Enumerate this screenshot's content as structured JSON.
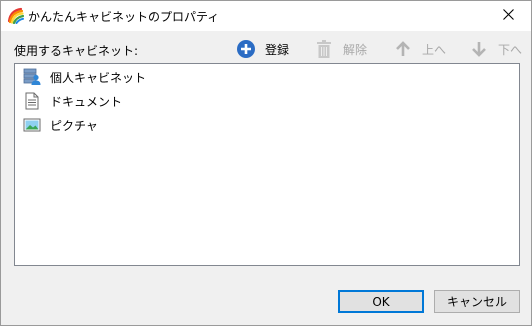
{
  "window": {
    "title": "かんたんキャビネットのプロパティ",
    "icon": "rainbow-pencils-icon",
    "close_icon": "close-icon"
  },
  "section": {
    "label": "使用するキャビネット:"
  },
  "toolbar": {
    "register": {
      "label": "登録",
      "icon": "plus-circle-icon",
      "enabled": true
    },
    "remove": {
      "label": "解除",
      "icon": "trash-icon",
      "enabled": false
    },
    "up": {
      "label": "上へ",
      "icon": "arrow-up-icon",
      "enabled": false
    },
    "down": {
      "label": "下へ",
      "icon": "arrow-down-icon",
      "enabled": false
    }
  },
  "cabinets": [
    {
      "label": "個人キャビネット",
      "icon": "personal-cabinet-icon"
    },
    {
      "label": "ドキュメント",
      "icon": "document-icon"
    },
    {
      "label": "ピクチャ",
      "icon": "picture-icon"
    }
  ],
  "buttons": {
    "ok": "OK",
    "cancel": "キャンセル"
  },
  "colors": {
    "accent": "#0078d7",
    "disabled_text": "#a8a8a8",
    "register_icon": "#2b6cc4"
  }
}
